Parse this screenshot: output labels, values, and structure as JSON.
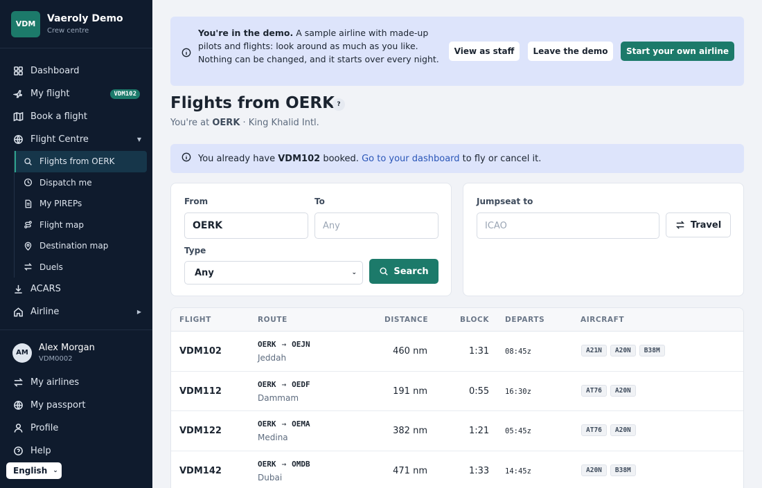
{
  "brand": {
    "logo": "VDM",
    "name": "Vaeroly Demo",
    "subtitle": "Crew centre"
  },
  "nav": {
    "dashboard": "Dashboard",
    "my_flight": "My flight",
    "my_flight_badge": "VDM102",
    "book_flight": "Book a flight",
    "flight_centre": "Flight Centre",
    "sub": {
      "flights_from": "Flights from OERK",
      "dispatch": "Dispatch me",
      "pireps": "My PIREPs",
      "flight_map": "Flight map",
      "destination_map": "Destination map",
      "duels": "Duels"
    },
    "acars": "ACARS",
    "airline": "Airline"
  },
  "user": {
    "initials": "AM",
    "name": "Alex Morgan",
    "id": "VDM0002"
  },
  "bottom_nav": {
    "my_airlines": "My airlines",
    "passport": "My passport",
    "profile": "Profile",
    "help": "Help"
  },
  "language": "English",
  "demo": {
    "bold": "You're in the demo.",
    "text": " A sample airline with made-up pilots and flights: look around as much as you like. Nothing can be changed, and it starts over every night.",
    "view_staff": "View as staff",
    "leave": "Leave the demo",
    "start_own": "Start your own airline"
  },
  "page": {
    "title": "Flights from OERK",
    "help": "?",
    "location_prefix": "You're at ",
    "location_code": "OERK",
    "location_name": " · King Khalid Intl."
  },
  "alert": {
    "prefix": "You already have ",
    "flight": "VDM102",
    "middle": " booked. ",
    "link": "Go to your dashboard",
    "suffix": " to fly or cancel it."
  },
  "search": {
    "from_label": "From",
    "from_value": "OERK",
    "to_label": "To",
    "to_placeholder": "Any",
    "type_label": "Type",
    "type_value": "Any",
    "search_button": "Search"
  },
  "jumpseat": {
    "label": "Jumpseat to",
    "placeholder": "ICAO",
    "travel_button": "Travel"
  },
  "table": {
    "headers": {
      "flight": "FLIGHT",
      "route": "ROUTE",
      "distance": "DISTANCE",
      "block": "BLOCK",
      "departs": "DEPARTS",
      "aircraft": "AIRCRAFT"
    },
    "rows": [
      {
        "flight": "VDM102",
        "from": "OERK",
        "to": "OEJN",
        "city": "Jeddah",
        "distance": "460 nm",
        "block": "1:31",
        "departs": "08:45z",
        "aircraft": [
          "A21N",
          "A20N",
          "B38M"
        ]
      },
      {
        "flight": "VDM112",
        "from": "OERK",
        "to": "OEDF",
        "city": "Dammam",
        "distance": "191 nm",
        "block": "0:55",
        "departs": "16:30z",
        "aircraft": [
          "AT76",
          "A20N"
        ]
      },
      {
        "flight": "VDM122",
        "from": "OERK",
        "to": "OEMA",
        "city": "Medina",
        "distance": "382 nm",
        "block": "1:21",
        "departs": "05:45z",
        "aircraft": [
          "AT76",
          "A20N"
        ]
      },
      {
        "flight": "VDM142",
        "from": "OERK",
        "to": "OMDB",
        "city": "Dubai",
        "distance": "471 nm",
        "block": "1:33",
        "departs": "14:45z",
        "aircraft": [
          "A20N",
          "B38M"
        ]
      }
    ]
  }
}
